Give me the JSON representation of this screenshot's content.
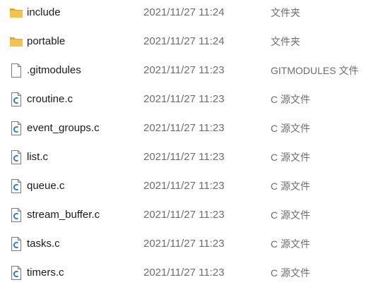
{
  "files": [
    {
      "name": "include",
      "date": "2021/11/27 11:24",
      "type": "文件夹",
      "icon": "folder-icon"
    },
    {
      "name": "portable",
      "date": "2021/11/27 11:24",
      "type": "文件夹",
      "icon": "folder-icon"
    },
    {
      "name": ".gitmodules",
      "date": "2021/11/27 11:23",
      "type": "GITMODULES 文件",
      "icon": "blank-file-icon"
    },
    {
      "name": "croutine.c",
      "date": "2021/11/27 11:23",
      "type": "C 源文件",
      "icon": "c-source-file-icon"
    },
    {
      "name": "event_groups.c",
      "date": "2021/11/27 11:23",
      "type": "C 源文件",
      "icon": "c-source-file-icon"
    },
    {
      "name": "list.c",
      "date": "2021/11/27 11:23",
      "type": "C 源文件",
      "icon": "c-source-file-icon"
    },
    {
      "name": "queue.c",
      "date": "2021/11/27 11:23",
      "type": "C 源文件",
      "icon": "c-source-file-icon"
    },
    {
      "name": "stream_buffer.c",
      "date": "2021/11/27 11:23",
      "type": "C 源文件",
      "icon": "c-source-file-icon"
    },
    {
      "name": "tasks.c",
      "date": "2021/11/27 11:23",
      "type": "C 源文件",
      "icon": "c-source-file-icon"
    },
    {
      "name": "timers.c",
      "date": "2021/11/27 11:23",
      "type": "C 源文件",
      "icon": "c-source-file-icon"
    }
  ],
  "colors": {
    "folder": "#f4c24e",
    "folder_dark": "#e0a82e",
    "c_icon": "#2b7bd3",
    "text": "#1a1a1a",
    "muted": "#6d6d6d"
  }
}
